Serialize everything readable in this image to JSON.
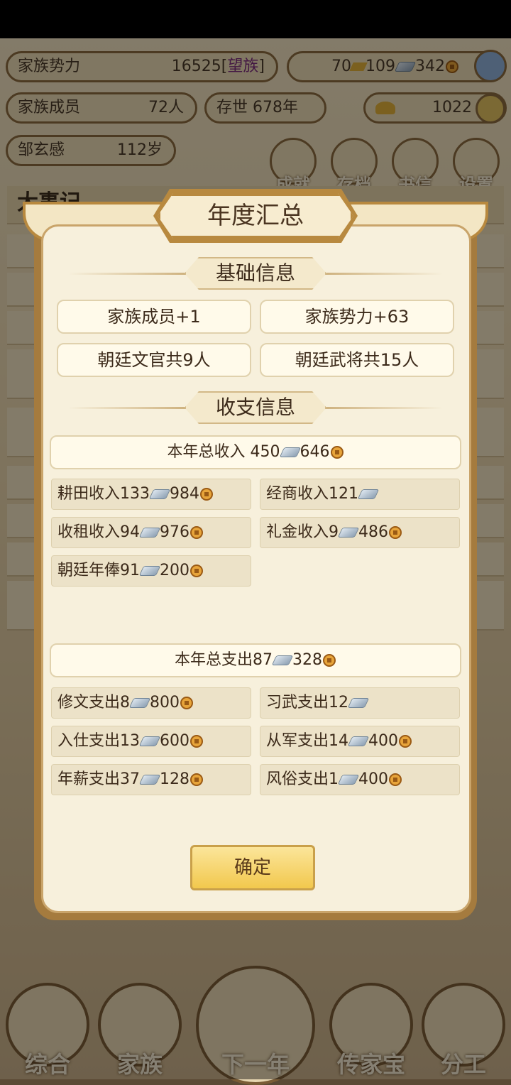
{
  "background": {
    "family_power": {
      "label": "家族势力",
      "value": "16525",
      "rank": "望族"
    },
    "currency": {
      "gold": "70",
      "silver": "109",
      "coin": "342"
    },
    "family_members": {
      "label": "家族成员",
      "value": "72人"
    },
    "existing": {
      "label": "存世",
      "value": "678年"
    },
    "ingot": "1022",
    "leader": {
      "name": "邹玄感",
      "age": "112岁"
    },
    "menu": [
      "成就",
      "存档",
      "书信",
      "设置"
    ],
    "chronicle_title": "大事记",
    "nav": [
      "综合",
      "家族",
      "下一年",
      "传家宝",
      "分工"
    ]
  },
  "modal": {
    "title": "年度汇总",
    "basic_section": "基础信息",
    "basic": [
      "家族成员+1",
      "家族势力+63",
      "朝廷文官共9人",
      "朝廷武将共15人"
    ],
    "finance_section": "收支信息",
    "income_total": {
      "label": "本年总收入 450",
      "coin": "646"
    },
    "income": [
      {
        "label": "耕田收入133",
        "coin": "984"
      },
      {
        "label": "经商收入121",
        "coin": ""
      },
      {
        "label": "收租收入94",
        "coin": "976"
      },
      {
        "label": "礼金收入9",
        "coin": "486"
      },
      {
        "label": "朝廷年俸91",
        "coin": "200"
      }
    ],
    "expense_total": {
      "label": "本年总支出87",
      "coin": "328"
    },
    "expense": [
      {
        "label": "修文支出8",
        "coin": "800"
      },
      {
        "label": "习武支出12",
        "coin": ""
      },
      {
        "label": "入仕支出13",
        "coin": "600"
      },
      {
        "label": "从军支出14",
        "coin": "400"
      },
      {
        "label": "年薪支出37",
        "coin": "128"
      },
      {
        "label": "风俗支出1",
        "coin": "400"
      }
    ],
    "confirm": "确定"
  }
}
